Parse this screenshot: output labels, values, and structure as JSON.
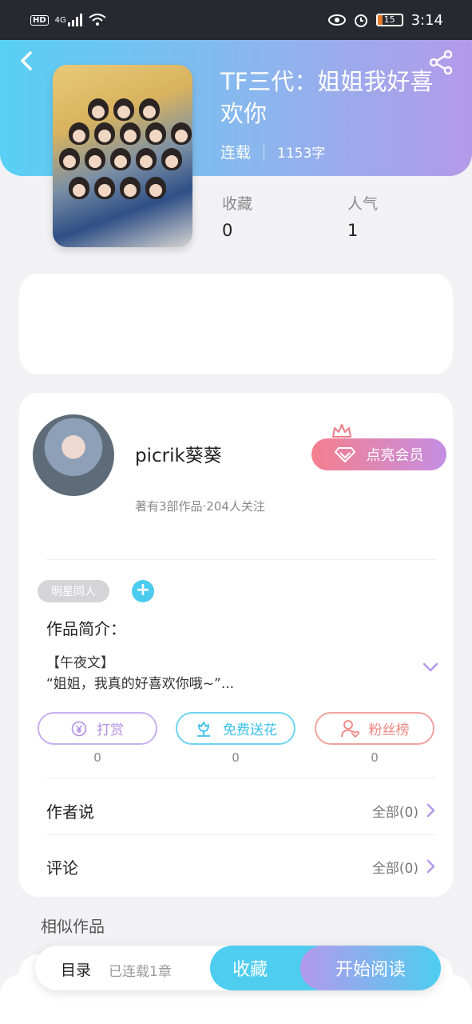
{
  "status_bar": {
    "left_label": "HD",
    "network": "4G",
    "time": "3:14",
    "battery": "15"
  },
  "book": {
    "title": "TF三代：姐姐我好喜欢你",
    "status": "连载",
    "word_count": "1153字",
    "stats": [
      {
        "label": "收藏",
        "value": "0"
      },
      {
        "label": "人气",
        "value": "1"
      }
    ]
  },
  "author": {
    "name": "picrik葵葵",
    "subtitle": "著有3部作品·204人关注",
    "vip_button": "点亮会员"
  },
  "tag": {
    "label": "明星同人",
    "add": "+"
  },
  "intro": {
    "title": "作品简介：",
    "line1": "【午夜文】",
    "line2": "“姐姐，我真的好喜欢你哦~”..."
  },
  "actions": [
    {
      "label": "打赏",
      "count": "0",
      "icon": "yen-coin-icon",
      "color": "#b28fe3"
    },
    {
      "label": "免费送花",
      "count": "0",
      "icon": "flower-icon",
      "color": "#4ecdf0"
    },
    {
      "label": "粉丝榜",
      "count": "0",
      "icon": "fan-ranking-icon",
      "color": "#ef8b85"
    }
  ],
  "links": {
    "author_says": {
      "label": "作者说",
      "value": "全部(0)"
    },
    "comments": {
      "label": "评论",
      "value": "全部(0)"
    }
  },
  "similar": {
    "title": "相似作品"
  },
  "bottom_bar": {
    "catalog": "目录",
    "catalog_sub": "已连载1章",
    "collect": "收藏",
    "read": "开始阅读"
  },
  "colors": {
    "accent_cyan": "#4ecdf0",
    "accent_purple": "#b399ec",
    "vip_pink": "#f57f8d"
  }
}
